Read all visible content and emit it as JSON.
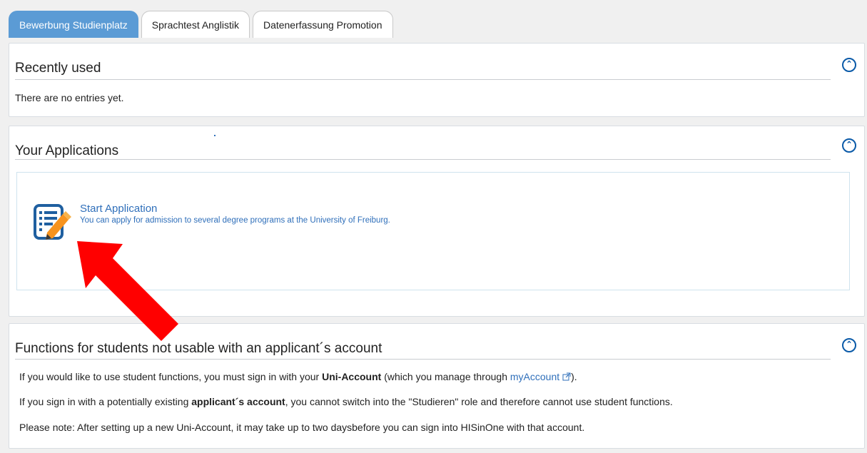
{
  "tabs": [
    {
      "label": "Bewerbung Studienplatz",
      "active": true
    },
    {
      "label": "Sprachtest Anglistik",
      "active": false
    },
    {
      "label": "Datenerfassung Promotion",
      "active": false
    }
  ],
  "recently_used": {
    "title": "Recently used",
    "empty_text": "There are no entries yet."
  },
  "applications": {
    "title": "Your Applications",
    "start_link": "Start Application",
    "start_description": "You can apply for admission to several degree programs at the University of Freiburg."
  },
  "functions": {
    "title": "Functions for students not usable with an applicant´s account",
    "line1_pre": "If you would like to use student functions, you must sign in with your ",
    "line1_bold": "Uni-Account",
    "line1_mid": " (which you manage through ",
    "line1_link": "myAccount",
    "line1_post": ").",
    "line2_pre": "If you sign in with a potentially existing ",
    "line2_bold": "applicant´s account",
    "line2_post": ", you cannot switch into the \"Studieren\" role and therefore cannot use student functions.",
    "line3": "Please note: After setting up a new Uni-Account, it may take up to two daysbefore you can sign into HISinOne with that account."
  },
  "colors": {
    "active_tab": "#5b9bd5",
    "link": "#2f6fba",
    "collapse_icon": "#0a5aa8",
    "annotation_arrow": "#ff0000",
    "icon_pencil": "#f7931e"
  },
  "icons": {
    "collapse": "chevron-up-circle-icon",
    "application": "form-edit-icon",
    "external": "external-link-icon"
  }
}
